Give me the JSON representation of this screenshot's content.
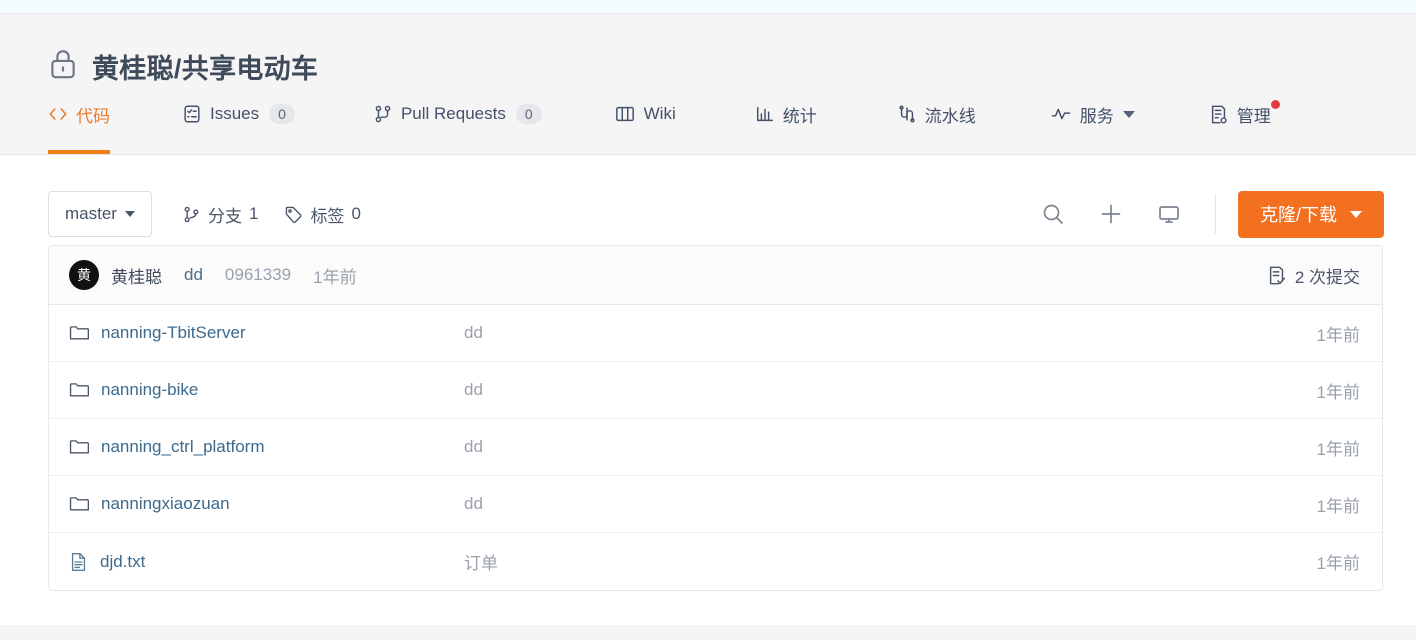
{
  "top_strip": {
    "color": "#f2fbfd"
  },
  "header": {
    "lock_icon": "lock-icon",
    "repo_title": "黄桂聪/共享电动车",
    "accent_color": "#ef8113"
  },
  "nav": {
    "items": [
      {
        "label": "代码",
        "icon": "code-icon",
        "active": true,
        "badge": null,
        "caret": false,
        "dot": false
      },
      {
        "label": "Issues",
        "icon": "issues-icon",
        "active": false,
        "badge": "0",
        "caret": false,
        "dot": false
      },
      {
        "label": "Pull Requests",
        "icon": "pull-request-icon",
        "active": false,
        "badge": "0",
        "caret": false,
        "dot": false
      },
      {
        "label": "Wiki",
        "icon": "wiki-icon",
        "active": false,
        "badge": null,
        "caret": false,
        "dot": false
      },
      {
        "label": "统计",
        "icon": "stats-icon",
        "active": false,
        "badge": null,
        "caret": false,
        "dot": false
      },
      {
        "label": "流水线",
        "icon": "pipeline-icon",
        "active": false,
        "badge": null,
        "caret": false,
        "dot": false
      },
      {
        "label": "服务",
        "icon": "service-icon",
        "active": false,
        "badge": null,
        "caret": true,
        "dot": false
      },
      {
        "label": "管理",
        "icon": "manage-icon",
        "active": false,
        "badge": null,
        "caret": false,
        "dot": true
      }
    ]
  },
  "toolbar": {
    "branch_label": "master",
    "branches_label": "分支",
    "branches_count": "1",
    "tags_label": "标签",
    "tags_count": "0",
    "search_icon": "search-icon",
    "add_icon": "plus-icon",
    "workspace_icon": "monitor-icon",
    "clone_label": "克隆/下载",
    "clone_color": "#f37021"
  },
  "commit_bar": {
    "avatar_text": "黄",
    "author": "黄桂聪",
    "message": "dd",
    "sha": "0961339",
    "time": "1年前",
    "commit_count_icon": "commit-history-icon",
    "commit_count_label": "2 次提交"
  },
  "files": [
    {
      "name": "nanning-TbitServer",
      "type": "folder",
      "message": "dd",
      "time": "1年前"
    },
    {
      "name": "nanning-bike",
      "type": "folder",
      "message": "dd",
      "time": "1年前"
    },
    {
      "name": "nanning_ctrl_platform",
      "type": "folder",
      "message": "dd",
      "time": "1年前"
    },
    {
      "name": "nanningxiaozuan",
      "type": "folder",
      "message": "dd",
      "time": "1年前"
    },
    {
      "name": "djd.txt",
      "type": "file",
      "message": "订单",
      "time": "1年前"
    }
  ]
}
